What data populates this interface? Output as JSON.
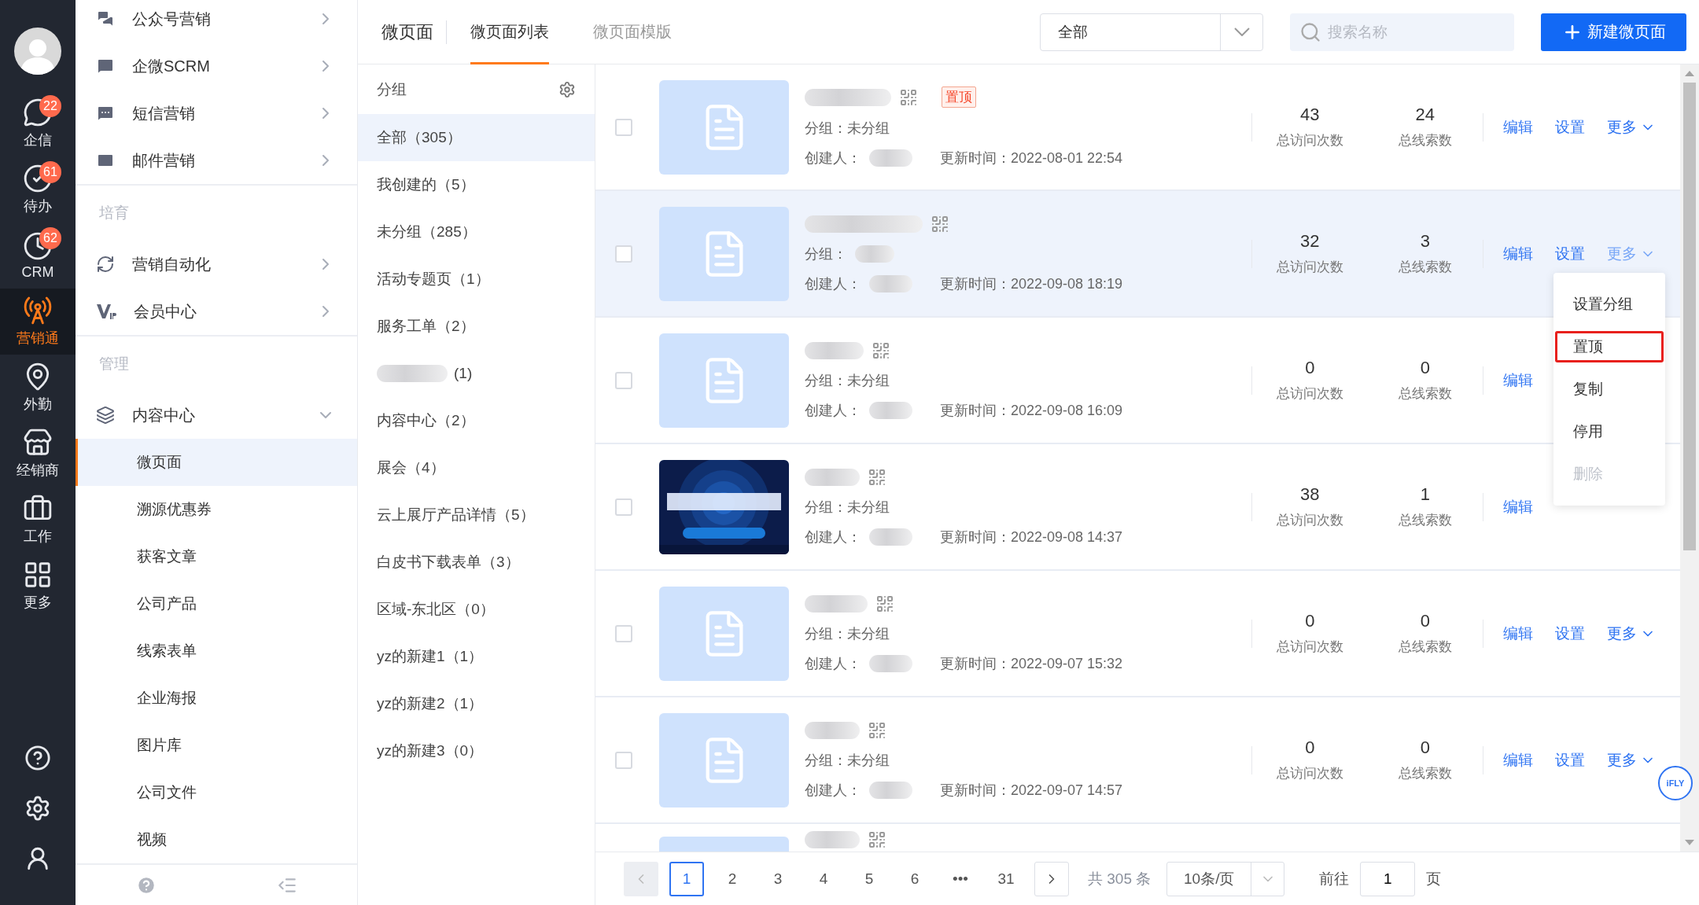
{
  "rail": {
    "items": [
      {
        "label": "企信",
        "badge": "22",
        "selected": false
      },
      {
        "label": "待办",
        "badge": "61",
        "selected": false
      },
      {
        "label": "CRM",
        "badge": "62",
        "selected": false
      },
      {
        "label": "营销通",
        "selected": true
      },
      {
        "label": "外勤",
        "selected": false
      },
      {
        "label": "经销商",
        "selected": false
      },
      {
        "label": "工作",
        "selected": false
      },
      {
        "label": "更多",
        "selected": false
      }
    ]
  },
  "nav": {
    "sections": [
      {
        "items": [
          {
            "label": "公众号营销",
            "expanded": false
          },
          {
            "label": "企微SCRM",
            "expanded": false
          },
          {
            "label": "短信营销",
            "expanded": false
          },
          {
            "label": "邮件营销",
            "expanded": false
          }
        ]
      },
      {
        "title": "培育",
        "items": [
          {
            "label": "营销自动化",
            "expanded": false
          },
          {
            "label": "会员中心",
            "expanded": false
          }
        ]
      },
      {
        "title": "管理",
        "items": [
          {
            "label": "内容中心",
            "expanded": true,
            "children": [
              {
                "label": "微页面",
                "selected": true
              },
              {
                "label": "溯源优惠券",
                "selected": false
              },
              {
                "label": "获客文章",
                "selected": false
              },
              {
                "label": "公司产品",
                "selected": false
              },
              {
                "label": "线索表单",
                "selected": false
              },
              {
                "label": "企业海报",
                "selected": false
              },
              {
                "label": "图片库",
                "selected": false
              },
              {
                "label": "公司文件",
                "selected": false
              },
              {
                "label": "视频",
                "selected": false
              }
            ]
          }
        ]
      }
    ]
  },
  "header": {
    "title": "微页面",
    "tabs": [
      {
        "label": "微页面列表",
        "selected": true
      },
      {
        "label": "微页面模版",
        "selected": false
      }
    ],
    "filter": "全部",
    "search": {
      "placeholder": "搜索名称"
    },
    "create_button": "新建微页面"
  },
  "groups": {
    "title": "分组",
    "items": [
      {
        "label": "全部（305）",
        "selected": true
      },
      {
        "label": "我创建的（5）",
        "selected": false
      },
      {
        "label": "未分组（285）",
        "selected": false
      },
      {
        "label": "活动专题页（1）",
        "selected": false
      },
      {
        "label": "服务工单（2）",
        "selected": false
      },
      {
        "label": "(1)",
        "redacted": true,
        "selected": false
      },
      {
        "label": "内容中心（2）",
        "selected": false
      },
      {
        "label": "展会（4）",
        "selected": false
      },
      {
        "label": "云上展厅产品详情（5）",
        "selected": false
      },
      {
        "label": "白皮书下载表单（3）",
        "selected": false
      },
      {
        "label": "区域-东北区（0）",
        "selected": false
      },
      {
        "label": "yz的新建1（1）",
        "selected": false
      },
      {
        "label": "yz的新建2（1）",
        "selected": false
      },
      {
        "label": "yz的新建3（0）",
        "selected": false
      }
    ]
  },
  "pages": [
    {
      "pin_tag": "置顶",
      "group": "分组：未分组",
      "creator": "创建人：",
      "updated": "更新时间：2022-08-01 22:54",
      "visits": "43",
      "visits_label": "总访问次数",
      "leads": "24",
      "leads_label": "总线索数",
      "actions": [
        "编辑",
        "设置",
        "更多"
      ],
      "checked": false,
      "highlighted": false
    },
    {
      "group": "分组：",
      "creator": "创建人：",
      "updated": "更新时间：2022-09-08 18:19",
      "visits": "32",
      "visits_label": "总访问次数",
      "leads": "3",
      "leads_label": "总线索数",
      "actions": [
        "编辑",
        "设置",
        "更多"
      ],
      "checked": false,
      "highlighted": true
    },
    {
      "group": "分组：未分组",
      "creator": "创建人：",
      "updated": "更新时间：2022-09-08 16:09",
      "visits": "0",
      "visits_label": "总访问次数",
      "leads": "0",
      "leads_label": "总线索数",
      "actions": [
        "编辑"
      ],
      "checked": false,
      "highlighted": false
    },
    {
      "kind": "picture",
      "group": "分组：未分组",
      "creator": "创建人：",
      "updated": "更新时间：2022-09-08 14:37",
      "visits": "38",
      "visits_label": "总访问次数",
      "leads": "1",
      "leads_label": "总线索数",
      "actions": [
        "编辑"
      ],
      "checked": false,
      "highlighted": false
    },
    {
      "group": "分组：未分组",
      "creator": "创建人：",
      "updated": "更新时间：2022-09-07 15:32",
      "visits": "0",
      "visits_label": "总访问次数",
      "leads": "0",
      "leads_label": "总线索数",
      "actions": [
        "编辑",
        "设置",
        "更多"
      ],
      "checked": false,
      "highlighted": false
    },
    {
      "group": "分组：未分组",
      "creator": "创建人：",
      "updated": "更新时间：2022-09-07 14:57",
      "visits": "0",
      "visits_label": "总访问次数",
      "leads": "0",
      "leads_label": "总线索数",
      "actions": [
        "编辑",
        "设置",
        "更多"
      ],
      "checked": false,
      "highlighted": false
    },
    {
      "highlighted": false
    }
  ],
  "more_menu": {
    "items": [
      {
        "label": "设置分组",
        "outlined": false,
        "disabled": false
      },
      {
        "label": "置顶",
        "outlined": true,
        "disabled": false
      },
      {
        "label": "复制",
        "outlined": false,
        "disabled": false
      },
      {
        "label": "停用",
        "outlined": false,
        "disabled": false
      },
      {
        "label": "删除",
        "outlined": false,
        "disabled": true
      }
    ]
  },
  "float_badge": "iFLY",
  "pagination": {
    "pages": [
      {
        "label": "1",
        "selected": true
      },
      {
        "label": "2",
        "selected": false
      },
      {
        "label": "3",
        "selected": false
      },
      {
        "label": "4",
        "selected": false
      },
      {
        "label": "5",
        "selected": false
      },
      {
        "label": "6",
        "selected": false
      },
      {
        "label": "•••",
        "selected": false
      },
      {
        "label": "31",
        "selected": false
      }
    ],
    "total": "共 305 条",
    "page_size": "10条/页",
    "goto_label": "前往",
    "goto_value": "1",
    "goto_suffix": "页"
  }
}
